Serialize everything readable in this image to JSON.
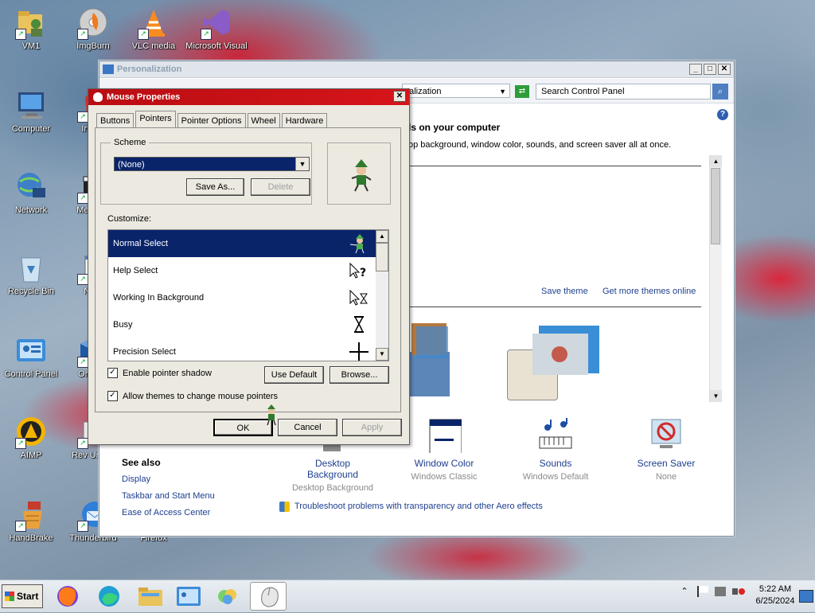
{
  "desktop": {
    "icons": [
      {
        "label": "VM1"
      },
      {
        "label": "ImgBurn"
      },
      {
        "label": "VLC media"
      },
      {
        "label": "Microsoft Visual"
      },
      {
        "label": "Computer"
      },
      {
        "label": "IrfanV"
      },
      {
        "label": "Network"
      },
      {
        "label": "Media G"
      },
      {
        "label": "Recycle Bin"
      },
      {
        "label": "Note"
      },
      {
        "label": "Control Panel"
      },
      {
        "label": "Ora Virt"
      },
      {
        "label": "AIMP"
      },
      {
        "label": "Rev Uninst"
      },
      {
        "label": "HandBrake"
      },
      {
        "label": "Thunderbird"
      },
      {
        "label": "Firefox"
      }
    ]
  },
  "personalization": {
    "title": "Personalization",
    "address_text": "nalization",
    "search_placeholder": "Search Control Panel",
    "heading": "ls on your computer",
    "subtext": "op background, window color, sounds, and screen saver all at once.",
    "save_theme": "Save theme",
    "get_more_themes": "Get more themes online",
    "bottom_items": [
      {
        "title": "Desktop Background",
        "subtitle": "Desktop Background"
      },
      {
        "title": "Window Color",
        "subtitle": "Windows Classic"
      },
      {
        "title": "Sounds",
        "subtitle": "Windows Default"
      },
      {
        "title": "Screen Saver",
        "subtitle": "None"
      }
    ],
    "see_also": {
      "title": "See also",
      "links": [
        "Display",
        "Taskbar and Start Menu",
        "Ease of Access Center"
      ]
    },
    "troubleshoot": "Troubleshoot problems with transparency and other Aero effects"
  },
  "mouse": {
    "title": "Mouse Properties",
    "tabs": [
      "Buttons",
      "Pointers",
      "Pointer Options",
      "Wheel",
      "Hardware"
    ],
    "active_tab": "Pointers",
    "scheme_label": "Scheme",
    "scheme_value": "(None)",
    "save_as": "Save As...",
    "delete": "Delete",
    "customize_label": "Customize:",
    "pointers": [
      {
        "name": "Normal Select",
        "icon": "elf-cursor-icon"
      },
      {
        "name": "Help Select",
        "icon": "help-cursor-icon"
      },
      {
        "name": "Working In Background",
        "icon": "working-cursor-icon"
      },
      {
        "name": "Busy",
        "icon": "hourglass-icon"
      },
      {
        "name": "Precision Select",
        "icon": "crosshair-icon"
      }
    ],
    "enable_shadow": "Enable pointer shadow",
    "allow_themes": "Allow themes to change mouse pointers",
    "use_default": "Use Default",
    "browse": "Browse...",
    "ok": "OK",
    "cancel": "Cancel",
    "apply": "Apply"
  },
  "taskbar": {
    "start": "Start",
    "time": "5:22 AM",
    "date": "6/25/2024"
  }
}
